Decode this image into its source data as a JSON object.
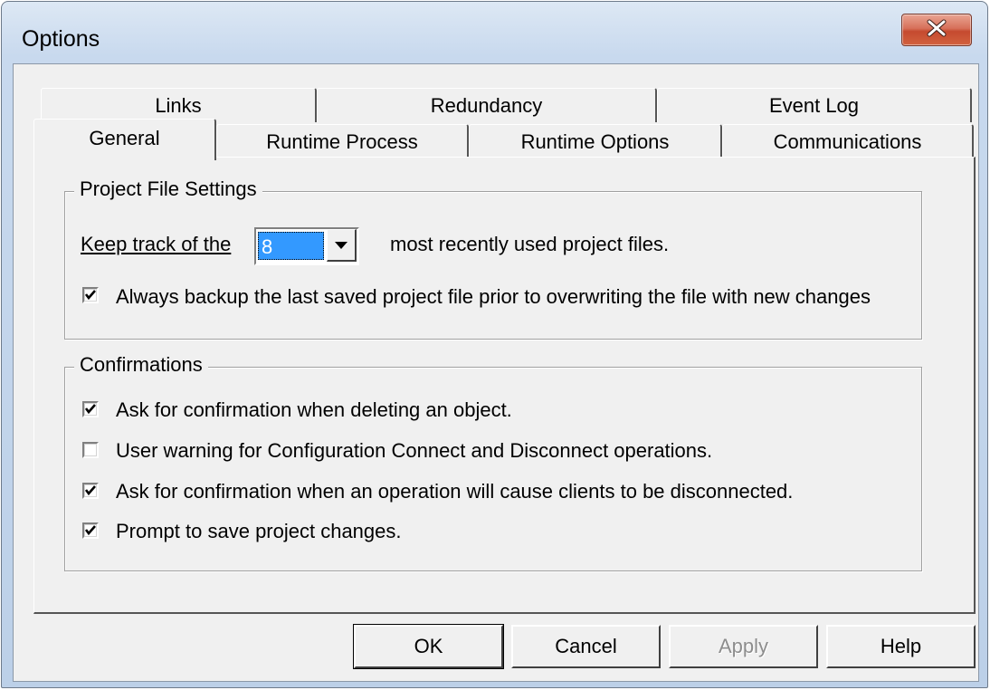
{
  "window": {
    "title": "Options",
    "close_icon": "close-x-icon"
  },
  "tabs": {
    "row_back": [
      {
        "label": "Links"
      },
      {
        "label": "Redundancy"
      },
      {
        "label": "Event Log"
      }
    ],
    "row_front": [
      {
        "label": "General",
        "selected": true
      },
      {
        "label": "Runtime Process"
      },
      {
        "label": "Runtime Options"
      },
      {
        "label": "Communications"
      }
    ]
  },
  "project_file_settings": {
    "title": "Project File Settings",
    "keep_track_prefix": "Keep track of the",
    "keep_track_value": "8",
    "keep_track_suffix": "most recently used project files.",
    "backup_label": "Always backup the last saved project file prior to overwriting the file with new changes",
    "backup_checked": true
  },
  "confirmations": {
    "title": "Confirmations",
    "items": [
      {
        "label": "Ask for confirmation when deleting an object.",
        "checked": true
      },
      {
        "label": "User warning for Configuration Connect and Disconnect operations.",
        "checked": false
      },
      {
        "label": "Ask for confirmation when an operation will cause clients to be disconnected.",
        "checked": true
      },
      {
        "label": "Prompt to save project changes.",
        "checked": true
      }
    ]
  },
  "buttons": {
    "ok": "OK",
    "cancel": "Cancel",
    "apply": "Apply",
    "help": "Help"
  }
}
